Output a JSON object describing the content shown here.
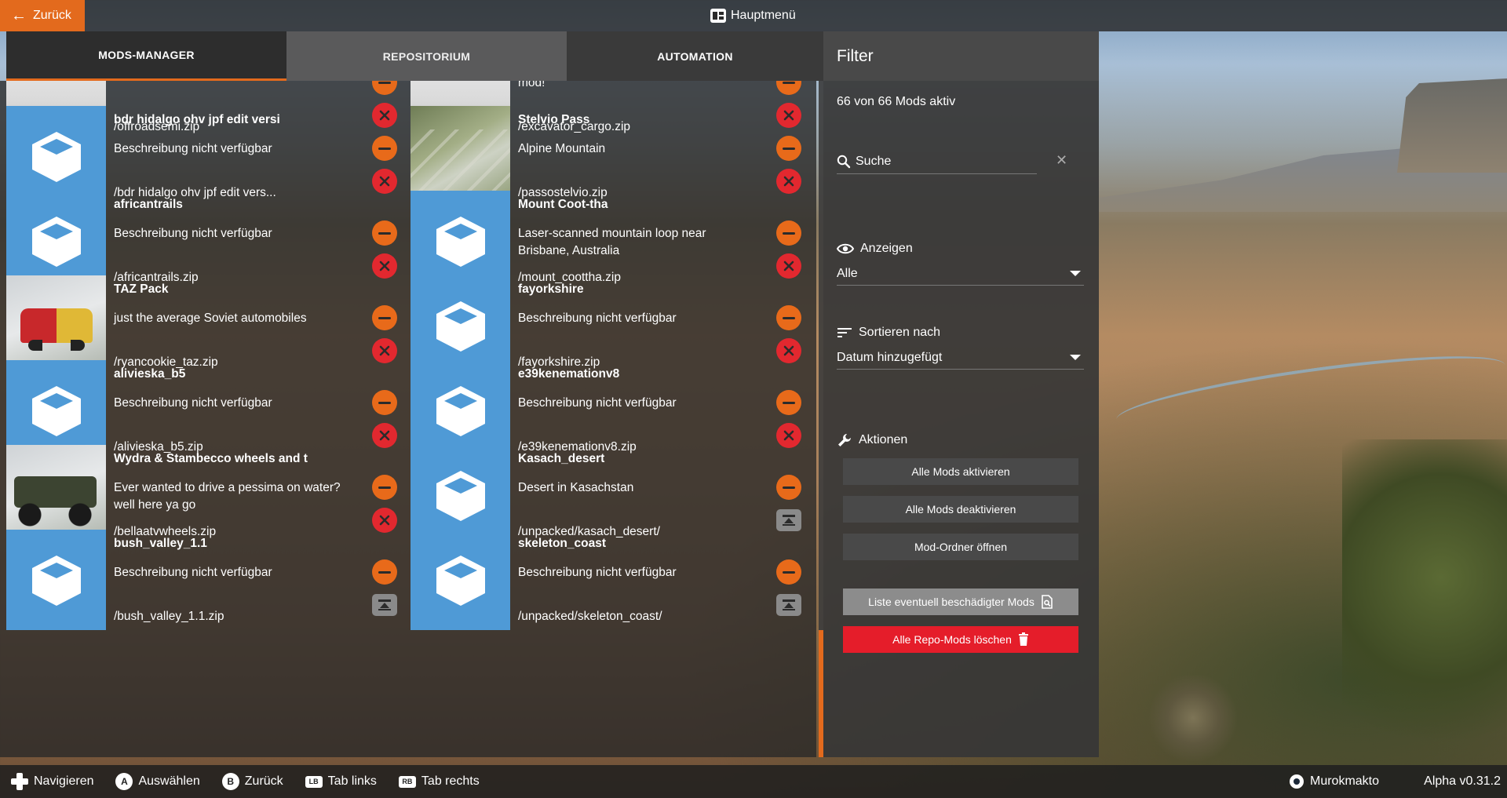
{
  "topbar": {
    "back_label": "Zurück",
    "title": "Hauptmenü"
  },
  "tabs": [
    {
      "label": "MODS-MANAGER",
      "active": true
    },
    {
      "label": "REPOSITORIUM",
      "active": false
    },
    {
      "label": "AUTOMATION",
      "active": false
    }
  ],
  "mods_left": [
    {
      "title": "",
      "desc": "",
      "path": "/offroadsemi.zip",
      "thumb": "offroad",
      "action": "remove"
    },
    {
      "title": "bdr hidalgo ohv jpf edit versi",
      "desc": "Beschreibung nicht verfügbar",
      "path": "/bdr hidalgo ohv jpf edit vers...",
      "thumb": "box",
      "action": "remove"
    },
    {
      "title": "africantrails",
      "desc": "Beschreibung nicht verfügbar",
      "path": "/africantrails.zip",
      "thumb": "box",
      "action": "remove"
    },
    {
      "title": "TAZ Pack",
      "desc": "just the average Soviet automobiles",
      "path": "/ryancookie_taz.zip",
      "thumb": "car",
      "action": "remove"
    },
    {
      "title": "alivieska_b5",
      "desc": "Beschreibung nicht verfügbar",
      "path": "/alivieska_b5.zip",
      "thumb": "box",
      "action": "remove"
    },
    {
      "title": "Wydra & Stambecco wheels and t",
      "desc": "Ever wanted to drive a pessima on water? well here ya go",
      "path": "/bellaatvwheels.zip",
      "thumb": "truck",
      "action": "remove"
    },
    {
      "title": "bush_valley_1.1",
      "desc": "Beschreibung nicht verfügbar",
      "path": "/bush_valley_1.1.zip",
      "thumb": "box",
      "action": "upload"
    }
  ],
  "mods_right": [
    {
      "title": "",
      "desc": "mod!",
      "path": "/excavator_cargo.zip",
      "thumb": "offroad",
      "action": "remove"
    },
    {
      "title": "Stelvio Pass",
      "desc": "Alpine Mountain",
      "path": "/passostelvio.zip",
      "thumb": "mountain",
      "action": "remove"
    },
    {
      "title": "Mount Coot-tha",
      "desc": "Laser-scanned mountain loop near Brisbane, Australia",
      "path": "/mount_coottha.zip",
      "thumb": "box",
      "action": "remove"
    },
    {
      "title": "fayorkshire",
      "desc": "Beschreibung nicht verfügbar",
      "path": "/fayorkshire.zip",
      "thumb": "box",
      "action": "remove"
    },
    {
      "title": "e39kenemationv8",
      "desc": "Beschreibung nicht verfügbar",
      "path": "/e39kenemationv8.zip",
      "thumb": "box",
      "action": "remove"
    },
    {
      "title": "Kasach_desert",
      "desc": "Desert in Kasachstan",
      "path": "/unpacked/kasach_desert/",
      "thumb": "box",
      "action": "upload"
    },
    {
      "title": "skeleton_coast",
      "desc": "Beschreibung nicht verfügbar",
      "path": "/unpacked/skeleton_coast/",
      "thumb": "box",
      "action": "upload"
    }
  ],
  "filter": {
    "title": "Filter",
    "count": "66 von 66 Mods aktiv",
    "search_value": "Suche",
    "show_label": "Anzeigen",
    "show_value": "Alle",
    "sort_label": "Sortieren nach",
    "sort_value": "Datum hinzugefügt",
    "actions_label": "Aktionen",
    "btn_activate_all": "Alle Mods aktivieren",
    "btn_deactivate_all": "Alle Mods deaktivieren",
    "btn_open_folder": "Mod-Ordner öffnen",
    "btn_damaged": "Liste eventuell beschädigter Mods",
    "btn_delete_repo": "Alle Repo-Mods löschen"
  },
  "bottombar": {
    "hints": [
      {
        "key": "",
        "label": "Navigieren",
        "type": "dpad"
      },
      {
        "key": "A",
        "label": "Auswählen",
        "type": "button"
      },
      {
        "key": "B",
        "label": "Zurück",
        "type": "button"
      },
      {
        "key": "LB",
        "label": "Tab links",
        "type": "bumper"
      },
      {
        "key": "RB",
        "label": "Tab rechts",
        "type": "bumper"
      }
    ],
    "username": "Murokmakto",
    "version": "Alpha v0.31.2"
  },
  "colors": {
    "accent": "#e36a1d",
    "danger": "#e2282f",
    "mod_tile": "#4f9ad6"
  }
}
